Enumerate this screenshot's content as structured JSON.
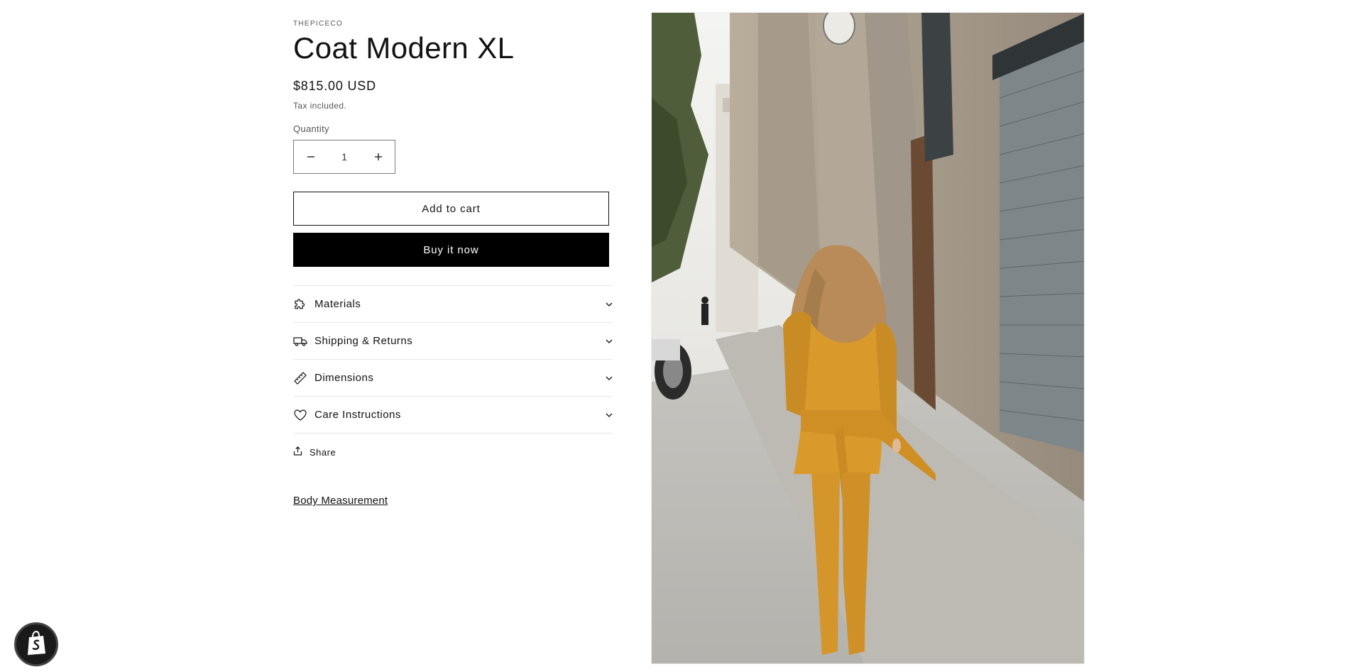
{
  "product": {
    "vendor": "THEPICECO",
    "title": "Coat Modern XL",
    "price": "$815.00 USD",
    "tax_note": "Tax included."
  },
  "quantity": {
    "label": "Quantity",
    "value": "1",
    "decrease_icon": "minus-icon",
    "increase_icon": "plus-icon"
  },
  "buttons": {
    "add_to_cart": "Add to cart",
    "buy_now": "Buy it now"
  },
  "accordion": [
    {
      "label": "Materials",
      "icon": "puzzle-icon"
    },
    {
      "label": "Shipping & Returns",
      "icon": "truck-icon"
    },
    {
      "label": "Dimensions",
      "icon": "ruler-icon"
    },
    {
      "label": "Care Instructions",
      "icon": "heart-icon"
    }
  ],
  "share": {
    "label": "Share",
    "icon": "share-icon"
  },
  "body_measurement": "Body Measurement",
  "media": {
    "subject": "woman in mustard suit walking on city street",
    "accent": "#d99a2b"
  },
  "colors": {
    "button_dark": "#000000",
    "text": "#121212"
  }
}
